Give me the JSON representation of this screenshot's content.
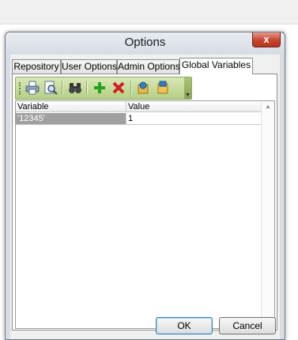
{
  "dialog": {
    "title": "Options",
    "close_glyph": "x"
  },
  "tabs": [
    {
      "label": "Repository",
      "active": false
    },
    {
      "label": "User Options",
      "active": false
    },
    {
      "label": "Admin Options",
      "active": false
    },
    {
      "label": "Global Variables",
      "active": true
    }
  ],
  "toolbar": {
    "buttons": [
      {
        "icon": "print-icon",
        "color": "#5a6f8c"
      },
      {
        "icon": "print-preview-icon",
        "color": "#5a6f8c"
      },
      {
        "icon": "binoculars-icon",
        "color": "#333333"
      },
      {
        "icon": "add-icon",
        "color": "#22a31c"
      },
      {
        "icon": "delete-icon",
        "color": "#d21f1f"
      },
      {
        "icon": "import-icon",
        "color": "#2e7fd0"
      },
      {
        "icon": "export-icon",
        "color": "#e0a020"
      }
    ],
    "overflow_glyph": "▾"
  },
  "grid": {
    "columns": [
      "Variable",
      "Value"
    ],
    "rows": [
      {
        "variable": "'12345'",
        "value": "1"
      }
    ],
    "scroll_up": "▲",
    "scroll_down": "▼"
  },
  "buttons": {
    "ok": "OK",
    "cancel": "Cancel"
  },
  "colors": {
    "selection": "#a0a0a0",
    "close_button": "#c8452f",
    "toolbar": "#b5cf84"
  }
}
